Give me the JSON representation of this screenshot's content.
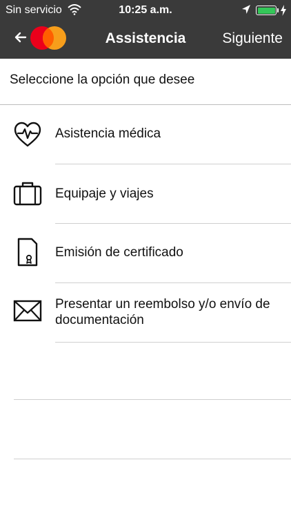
{
  "status_bar": {
    "carrier": "Sin servicio",
    "time": "10:25 a.m.",
    "battery_color": "#34c759"
  },
  "nav_bar": {
    "background": "#3a3a3a",
    "title": "Assistencia",
    "next_label": "Siguiente",
    "logo_colors": {
      "left": "#eb001b",
      "right": "#f79e1b"
    }
  },
  "prompt": "Seleccione la opción que desee",
  "options": [
    {
      "icon": "heart-pulse-icon",
      "label": "Asistencia médica"
    },
    {
      "icon": "suitcase-icon",
      "label": "Equipaje y viajes"
    },
    {
      "icon": "certificate-icon",
      "label": "Emisión de certificado"
    },
    {
      "icon": "envelope-icon",
      "label": "Presentar un reembolso y/o envío de documentación"
    }
  ]
}
